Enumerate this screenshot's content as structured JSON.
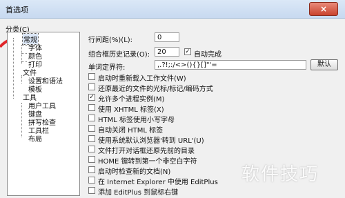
{
  "window": {
    "title": "首选项",
    "close_glyph": "×"
  },
  "category": {
    "label": "分类(C)",
    "tree": [
      {
        "label": "常规",
        "selected": true
      },
      {
        "label": "字体"
      },
      {
        "label": "颜色"
      },
      {
        "label": "打印"
      },
      {
        "label": "文件"
      },
      {
        "label": "设置和语法"
      },
      {
        "label": "模板"
      },
      {
        "label": "工具"
      },
      {
        "label": "用户工具"
      },
      {
        "label": "键盘"
      },
      {
        "label": "拼写检查"
      },
      {
        "label": "工具栏"
      },
      {
        "label": "布局"
      }
    ]
  },
  "settings": {
    "line_spacing": {
      "label": "行间距(%)(L):",
      "value": "0"
    },
    "history": {
      "label": "组合框历史记录(O):",
      "value": "20"
    },
    "autocomplete": {
      "label": "自动完成",
      "checked": true
    },
    "delimiters": {
      "label": "单词定界符:",
      "value": ",.?!;:/<>(){}[]\"'=",
      "default_btn": "默认"
    },
    "options": [
      {
        "label": "启动时重新载入工作文件(W)",
        "checked": false
      },
      {
        "label": "还原最近的文件的光标/标记/编码方式",
        "checked": false
      },
      {
        "label": "允许多个进程实例(M)",
        "checked": true
      },
      {
        "label": "使用 XHTML 标签(X)",
        "checked": false
      },
      {
        "label": "HTML 标签使用小写字母",
        "checked": false
      },
      {
        "label": "自动关闭 HTML 标签",
        "checked": false
      },
      {
        "label": "使用系统默认浏览器'转到 URL'(U)",
        "checked": false
      },
      {
        "label": "文件打开对话框还原先前的目录",
        "checked": false
      },
      {
        "label": "HOME 键转到第一个非空白字符",
        "checked": false
      },
      {
        "label": "启动时检查新的文档(N)",
        "checked": false
      },
      {
        "label": "在 Internet Explorer 中使用 EditPlus",
        "checked": false
      },
      {
        "label": "添加 EditPlus 到鼠标右键",
        "checked": false
      }
    ]
  },
  "watermark": "软件技巧",
  "colors": {
    "selection": "#dbe6f6",
    "arrow": "#e0262b"
  }
}
